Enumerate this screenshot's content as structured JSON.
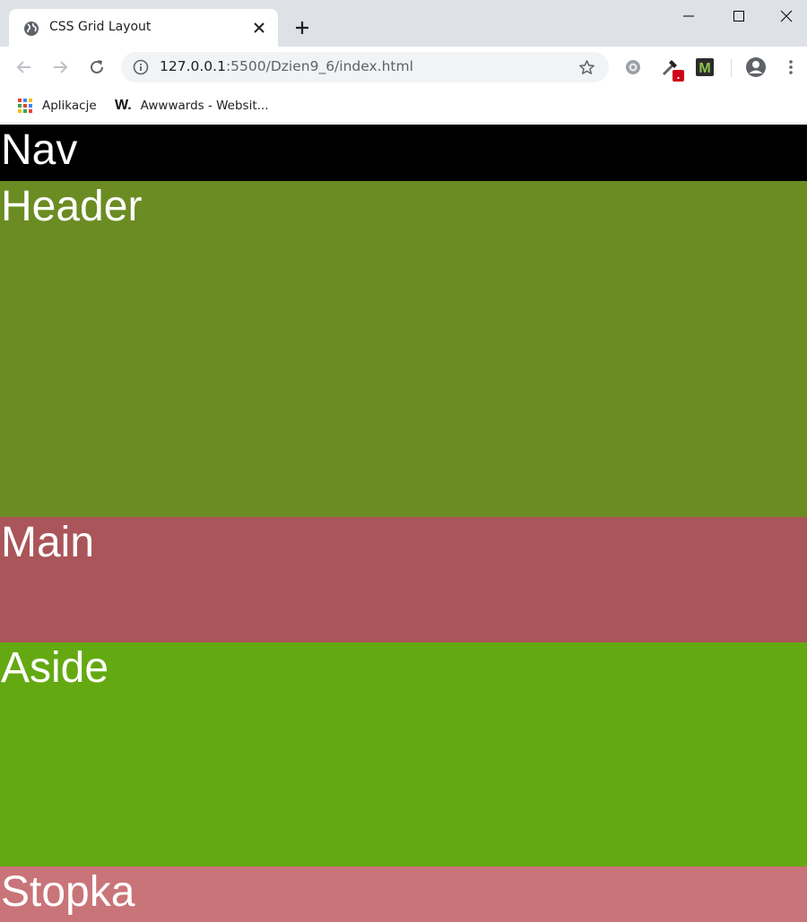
{
  "browser": {
    "tab": {
      "title": "CSS Grid Layout",
      "favicon": "globe-icon"
    },
    "address": {
      "host": "127.0.0.1",
      "rest": ":5500/Dzien9_6/index.html"
    },
    "bookmarks": [
      {
        "label": "Aplikacje",
        "icon": "apps-grid-icon"
      },
      {
        "label": "Awwwards - Websit...",
        "icon": "W."
      }
    ]
  },
  "page": {
    "nav": "Nav",
    "header": "Header",
    "main": "Main",
    "aside": "Aside",
    "footer": "Stopka"
  },
  "colors": {
    "nav": "#000000",
    "header": "#6b8c22",
    "main": "#aa5559",
    "aside": "#64a912",
    "footer": "#c97479"
  }
}
